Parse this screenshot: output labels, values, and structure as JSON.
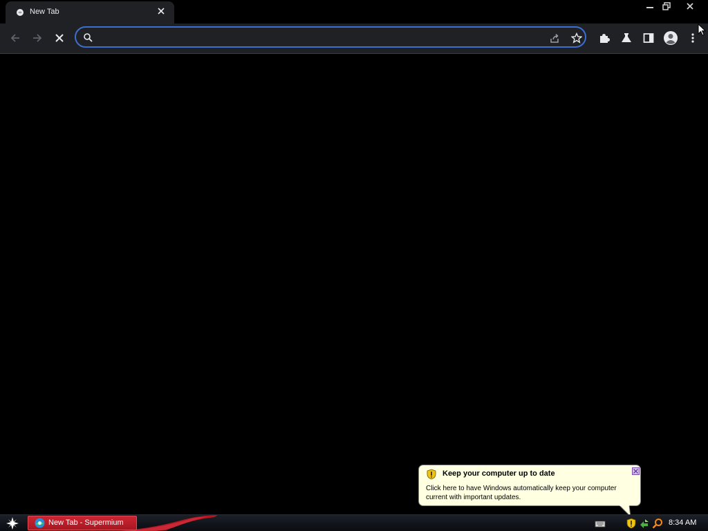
{
  "browser": {
    "tab": {
      "title": "New Tab",
      "favicon": "globe-icon",
      "close_icon": "close-icon"
    },
    "window_controls": [
      "minimize-icon",
      "restore-icon",
      "close-icon"
    ],
    "toolbar": {
      "back_icon": "arrow-left-icon",
      "forward_icon": "arrow-right-icon",
      "stop_icon": "stop-loading-icon",
      "omnibox": {
        "value": "",
        "placeholder": "",
        "search_icon": "search-icon",
        "share_icon": "share-icon",
        "bookmark_icon": "star-icon"
      },
      "extensions_icon": "puzzle-icon",
      "labs_icon": "flask-icon",
      "side_panel_icon": "side-panel-icon",
      "profile_icon": "profile-icon",
      "menu_icon": "kebab-menu-icon"
    },
    "accent_color": "#3b6fd1"
  },
  "balloon": {
    "title": "Keep your computer up to date",
    "body": "Click here to have Windows automatically keep your computer current with important updates.",
    "icon": "security-shield-icon",
    "close_icon": "close-icon"
  },
  "taskbar": {
    "start_icon": "star-start-icon",
    "items": [
      {
        "label": "New Tab - Supermium",
        "icon": "supermium-icon"
      }
    ],
    "tray_icons": [
      "keyboard-icon",
      "security-shield-icon",
      "network-icon",
      "search-icon"
    ],
    "clock": "8:34 AM"
  }
}
